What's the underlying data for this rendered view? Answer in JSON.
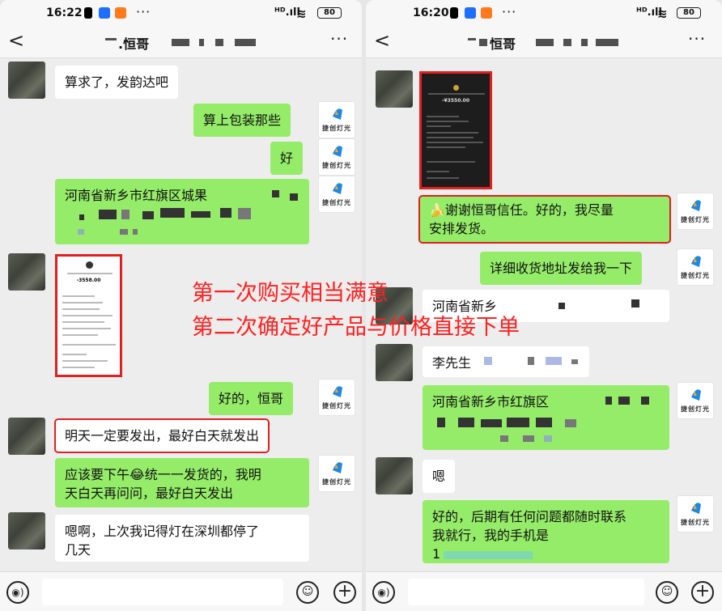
{
  "left": {
    "status": {
      "time": "16:22",
      "battery": "80",
      "more": "···",
      "signal": "ᴴᴰ.ıll"
    },
    "nav": {
      "back": "<",
      "title": ".恒哥",
      "menu": "···"
    },
    "messages": {
      "m1": "算求了，发韵达吧",
      "m2": "算上包装那些",
      "m3": "好",
      "m4": "河南省新乡市红旗区城果",
      "m5": "好的，恒哥",
      "m6": "明天一定要发出，最好白天就发出",
      "m7a": "应该要下午😂统一一发货的，我明",
      "m7b": "天白天再问问，最好白天发出",
      "m8a": "嗯啊，上次我记得灯在深圳都停了",
      "m8b": "几天"
    },
    "receipt_amount": "-3558.00",
    "logo_text": "捷创灯光"
  },
  "overlay": {
    "line1": "第一次购买相当满意",
    "line2": "第二次确定好产品与价格直接下单"
  },
  "right": {
    "status": {
      "time": "16:20",
      "battery": "80",
      "more": "···",
      "signal": "ᴴᴰ.ıll"
    },
    "nav": {
      "back": "<",
      "title": "恒哥",
      "menu": "···"
    },
    "messages": {
      "r1a": "🍌谢谢恒哥信任。好的，我尽量",
      "r1b": "安排发货。",
      "r2": "详细收货地址发给我一下",
      "r3": "河南省新乡",
      "r4": "李先生",
      "r5": "河南省新乡市红旗区",
      "r6": "嗯",
      "r7a": "好的，后期有任何问题都随时联系",
      "r7b": "我就行，我的手机是",
      "r7c": "1"
    },
    "receipt_amount": "-¥3550.00",
    "logo_text": "捷创灯光"
  },
  "colors": {
    "outgoing": "#95ec69",
    "incoming": "#ffffff",
    "highlight": "#e02020",
    "overlay_text": "#ff2020"
  }
}
